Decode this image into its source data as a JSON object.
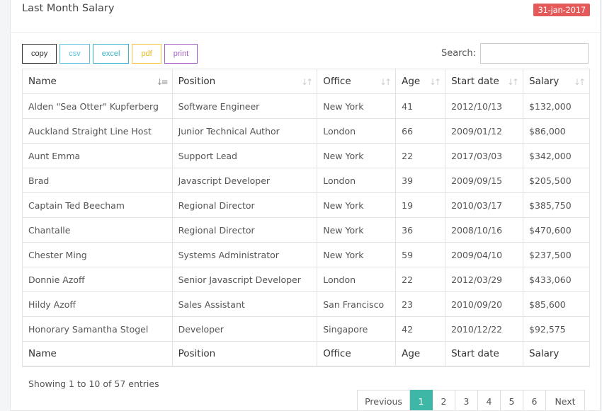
{
  "panel": {
    "title": "Last Month Salary",
    "date_badge": "31-jan-2017"
  },
  "toolbar": {
    "buttons": [
      "copy",
      "csv",
      "excel",
      "pdf",
      "print"
    ]
  },
  "search": {
    "label": "Search:",
    "value": "",
    "placeholder": ""
  },
  "table": {
    "headers": [
      "Name",
      "Position",
      "Office",
      "Age",
      "Start date",
      "Salary"
    ],
    "footers": [
      "Name",
      "Position",
      "Office",
      "Age",
      "Start date",
      "Salary"
    ],
    "rows": [
      [
        "Alden \"Sea Otter\" Kupferberg",
        "Software Engineer",
        "New York",
        "41",
        "2012/10/13",
        "$132,000"
      ],
      [
        "Auckland Straight Line Host",
        "Junior Technical Author",
        "London",
        "66",
        "2009/01/12",
        "$86,000"
      ],
      [
        "Aunt Emma",
        "Support Lead",
        "New York",
        "22",
        "2017/03/03",
        "$342,000"
      ],
      [
        "Brad",
        "Javascript Developer",
        "London",
        "39",
        "2009/09/15",
        "$205,500"
      ],
      [
        "Captain Ted Beecham",
        "Regional Director",
        "New York",
        "19",
        "2010/03/17",
        "$385,750"
      ],
      [
        "Chantalle",
        "Regional Director",
        "New York",
        "36",
        "2008/10/16",
        "$470,600"
      ],
      [
        "Chester Ming",
        "Systems Administrator",
        "New York",
        "59",
        "2009/04/10",
        "$237,500"
      ],
      [
        "Donnie Azoff",
        "Senior Javascript Developer",
        "London",
        "22",
        "2012/03/29",
        "$433,060"
      ],
      [
        "Hildy Azoff",
        "Sales Assistant",
        "San Francisco",
        "23",
        "2010/09/20",
        "$85,600"
      ],
      [
        "Honorary Samantha Stogel",
        "Developer",
        "Singapore",
        "42",
        "2010/12/22",
        "$92,575"
      ]
    ]
  },
  "info": "Showing 1 to 10 of 57 entries",
  "pagination": {
    "prev": "Previous",
    "pages": [
      "1",
      "2",
      "3",
      "4",
      "5",
      "6"
    ],
    "active": "1",
    "next": "Next"
  },
  "colors": {
    "badge": "#e45a5a",
    "active_page": "#3fb7a7"
  }
}
